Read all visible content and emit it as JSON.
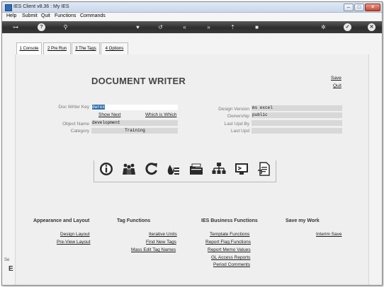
{
  "window": {
    "title": "IES Client v8.36 : My IES"
  },
  "menu": [
    "Help",
    "Submit",
    "Quit",
    "Functions",
    "Commands"
  ],
  "tabs": [
    {
      "label": "1 Console",
      "active": true
    },
    {
      "label": "2 Pre Run",
      "active": false
    },
    {
      "label": "3 The Tags",
      "active": false
    },
    {
      "label": "4 Options",
      "active": false
    }
  ],
  "header": {
    "title": "DOCUMENT WRITER",
    "save_label": "Save",
    "quit_label": "Quit"
  },
  "form": {
    "doc_writer_key_label": "Doc Writer Key",
    "doc_writer_key_value": "dwrex",
    "show_next_label": "Show Next",
    "which_is_which_label": "Which is Which",
    "object_name_label": "Object Name",
    "object_name_value": "development",
    "category_label": "Category",
    "category_value": "Training",
    "design_version_label": "Design Version",
    "design_version_value": "ms excel",
    "ownership_label": "Ownership",
    "ownership_value": "public",
    "last_upd_by_label": "Last Upd By",
    "last_upd_by_value": "",
    "last_upd_label": "Last Upd",
    "last_upd_value": ""
  },
  "icons": [
    "info-icon",
    "users-icon",
    "refresh-icon",
    "fire-list-icon",
    "folder-icon",
    "hierarchy-icon",
    "monitor-icon",
    "document-icon"
  ],
  "sections": {
    "appearance": {
      "title": "Appearance and Layout",
      "links": [
        "Design Layout",
        "Pre-View Layout"
      ]
    },
    "tag_functions": {
      "title": "Tag Functions",
      "links": [
        "Iterative Units",
        "Find New Tags",
        "Mass Edit Tag Names"
      ]
    },
    "business": {
      "title": "IES Business Functions",
      "links": [
        "Template Functions",
        "Report Flag Functions",
        "Report Memo Values",
        "GL Access Reports",
        "Period Comments"
      ]
    },
    "save_work": {
      "title": "Save my Work",
      "links": [
        "Interim Save"
      ]
    }
  },
  "left_edge": {
    "partial_label": "Se"
  },
  "colors": {
    "toolbar": "#3a3a3a",
    "selection": "#2f6fb3",
    "content_bg": "#efefef"
  }
}
